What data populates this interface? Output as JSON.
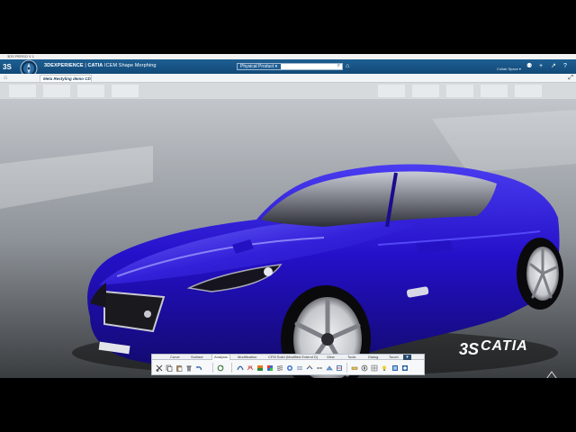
{
  "os_title": "3DS PERSO V 1",
  "topbar": {
    "brand": "3DEXPERIENCE",
    "separator": " | ",
    "product": "CATIA",
    "app_name": " ICEM Shape Morphing",
    "search_scope": "Physical Product",
    "search_value": "",
    "space_label": "Collab Space ▾"
  },
  "tab": {
    "title": "Meta Restyling demo CD1"
  },
  "icons": {
    "compass": "compass-icon",
    "search": "search-icon",
    "tag": "tag-icon",
    "user": "user-icon",
    "add": "add-icon",
    "share": "share-icon",
    "help": "help-icon",
    "home": "home-icon",
    "expand": "expand-icon"
  },
  "actionbar": {
    "tabs": [
      "Curve",
      "Surface",
      "Analysis",
      "Modification",
      "CFM Solid (Modified Extend D)",
      "View",
      "Tools",
      "Dialog",
      "Touch"
    ],
    "active_tab": "Analysis"
  },
  "watermark": {
    "text": "CATIA"
  },
  "colors": {
    "accent": "#124a78",
    "car_paint": "#2d16c7"
  }
}
